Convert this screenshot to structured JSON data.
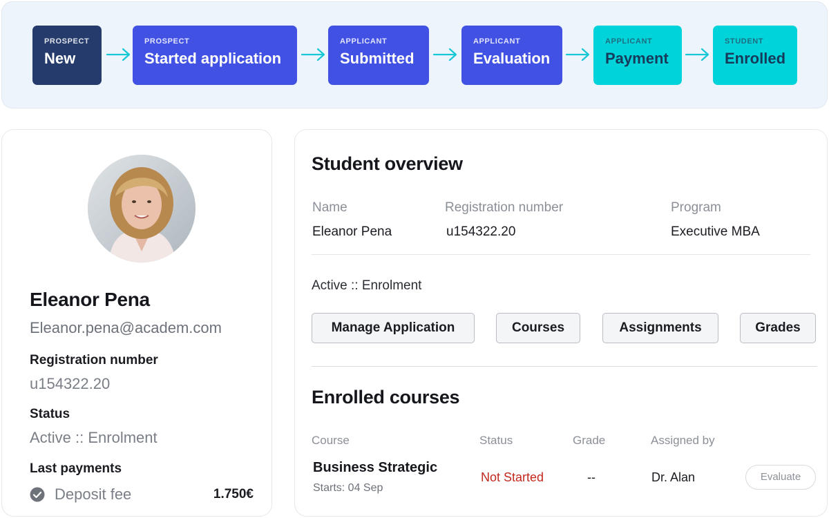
{
  "pipeline": {
    "stages": [
      {
        "tag": "PROSPECT",
        "label": "New"
      },
      {
        "tag": "PROSPECT",
        "label": "Started application"
      },
      {
        "tag": "APPLICANT",
        "label": "Submitted"
      },
      {
        "tag": "APPLICANT",
        "label": "Evaluation"
      },
      {
        "tag": "APPLICANT",
        "label": "Payment"
      },
      {
        "tag": "STUDENT",
        "label": "Enrolled"
      }
    ],
    "colors": {
      "current": "#243b6b",
      "blue": "#4151e3",
      "cyan": "#00d3da",
      "arrow": "#16c7d6"
    }
  },
  "profile": {
    "name": "Eleanor Pena",
    "email": "Eleanor.pena@academ.com",
    "registration_label": "Registration number",
    "registration_value": "u154322.20",
    "status_label": "Status",
    "status_value": "Active :: Enrolment",
    "payments_label": "Last payments",
    "payments": [
      {
        "name": "Deposit fee",
        "amount": "1.750€",
        "icon": "check-circle-icon"
      }
    ]
  },
  "overview": {
    "title": "Student overview",
    "columns": [
      {
        "header": "Name",
        "value": "Eleanor Pena"
      },
      {
        "header": "Registration number",
        "value": "u154322.20"
      },
      {
        "header": "Program",
        "value": "Executive MBA"
      }
    ],
    "status": "Active :: Enrolment",
    "actions": [
      "Manage Application",
      "Courses",
      "Assignments",
      "Grades"
    ]
  },
  "enrolled": {
    "title": "Enrolled courses",
    "headers": [
      "Course",
      "Status",
      "Grade",
      "Assigned by"
    ],
    "rows": [
      {
        "course": "Business Strategic",
        "starts": "Starts: 04 Sep",
        "status": "Not Started",
        "grade": "--",
        "assigned_by": "Dr. Alan",
        "action": "Evaluate"
      }
    ],
    "status_color": "#c2281d"
  }
}
